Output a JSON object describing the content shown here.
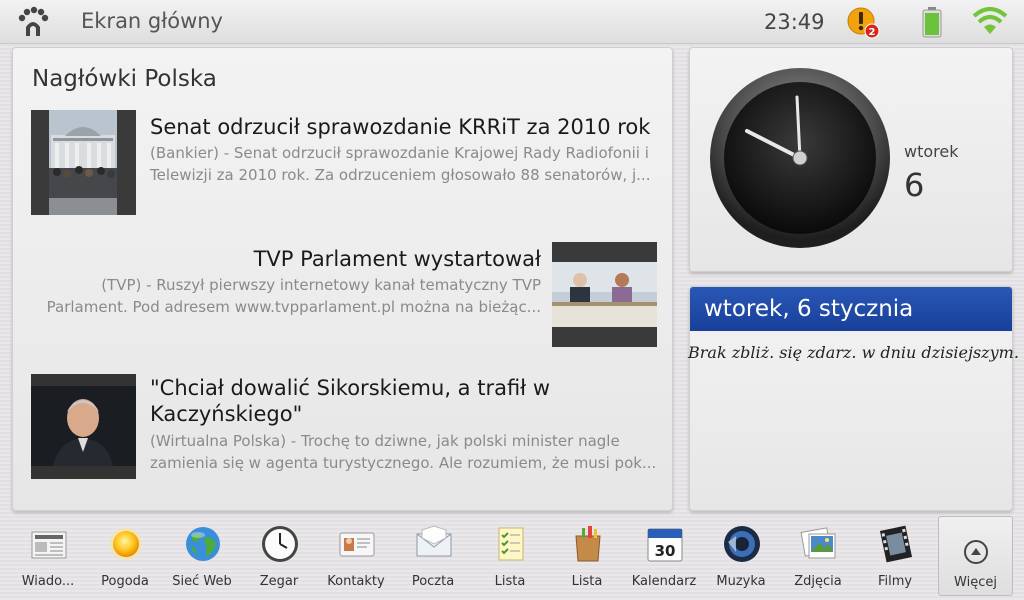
{
  "status_bar": {
    "title": "Ekran główny",
    "time": "23:49",
    "notification_count": "2"
  },
  "news": {
    "title": "Nagłówki Polska",
    "items": [
      {
        "headline": "Senat odrzucił sprawozdanie KRRiT za 2010 rok",
        "summary": "(Bankier) - Senat odrzucił sprawozdanie Krajowej Rady Radiofonii i Telewizji za 2010 rok. Za odrzuceniem głosowało 88 senatorów, j..."
      },
      {
        "headline": "TVP Parlament wystartował",
        "summary": "(TVP) - Ruszył pierwszy internetowy kanał tematyczny TVP Parlament. Pod adresem www.tvpparlament.pl można na bieżąc..."
      },
      {
        "headline": "\"Chciał dowalić Sikorskiemu, a trafił w Kaczyńskiego\"",
        "summary": "(Wirtualna Polska) - Trochę to dziwne, jak polski minister nagle zamienia się w agenta turystycznego. Ale rozumiem, że musi pok..."
      }
    ]
  },
  "clock": {
    "day_name": "wtorek",
    "day_number": "6"
  },
  "calendar": {
    "header": "wtorek, 6 stycznia",
    "empty_message": "Brak zbliż. się zdarz. w dniu dzisiejszym."
  },
  "dock": {
    "items": [
      {
        "label": "Wiado...",
        "icon": "newspaper-icon"
      },
      {
        "label": "Pogoda",
        "icon": "sun-icon"
      },
      {
        "label": "Sieć Web",
        "icon": "globe-icon"
      },
      {
        "label": "Zegar",
        "icon": "clock-icon"
      },
      {
        "label": "Kontakty",
        "icon": "contact-card-icon"
      },
      {
        "label": "Poczta",
        "icon": "envelope-icon"
      },
      {
        "label": "Lista",
        "icon": "checklist-icon"
      },
      {
        "label": "Lista",
        "icon": "shopping-bag-icon"
      },
      {
        "label": "Kalendarz",
        "icon": "calendar-icon"
      },
      {
        "label": "Muzyka",
        "icon": "speaker-icon"
      },
      {
        "label": "Zdjęcia",
        "icon": "photos-icon"
      },
      {
        "label": "Filmy",
        "icon": "film-icon"
      }
    ],
    "more_label": "Więcej"
  },
  "colors": {
    "calendar_header": "#1f4aa8",
    "battery_green": "#6cc23a",
    "wifi_green": "#74c43b",
    "alert_orange": "#f2a20c"
  }
}
